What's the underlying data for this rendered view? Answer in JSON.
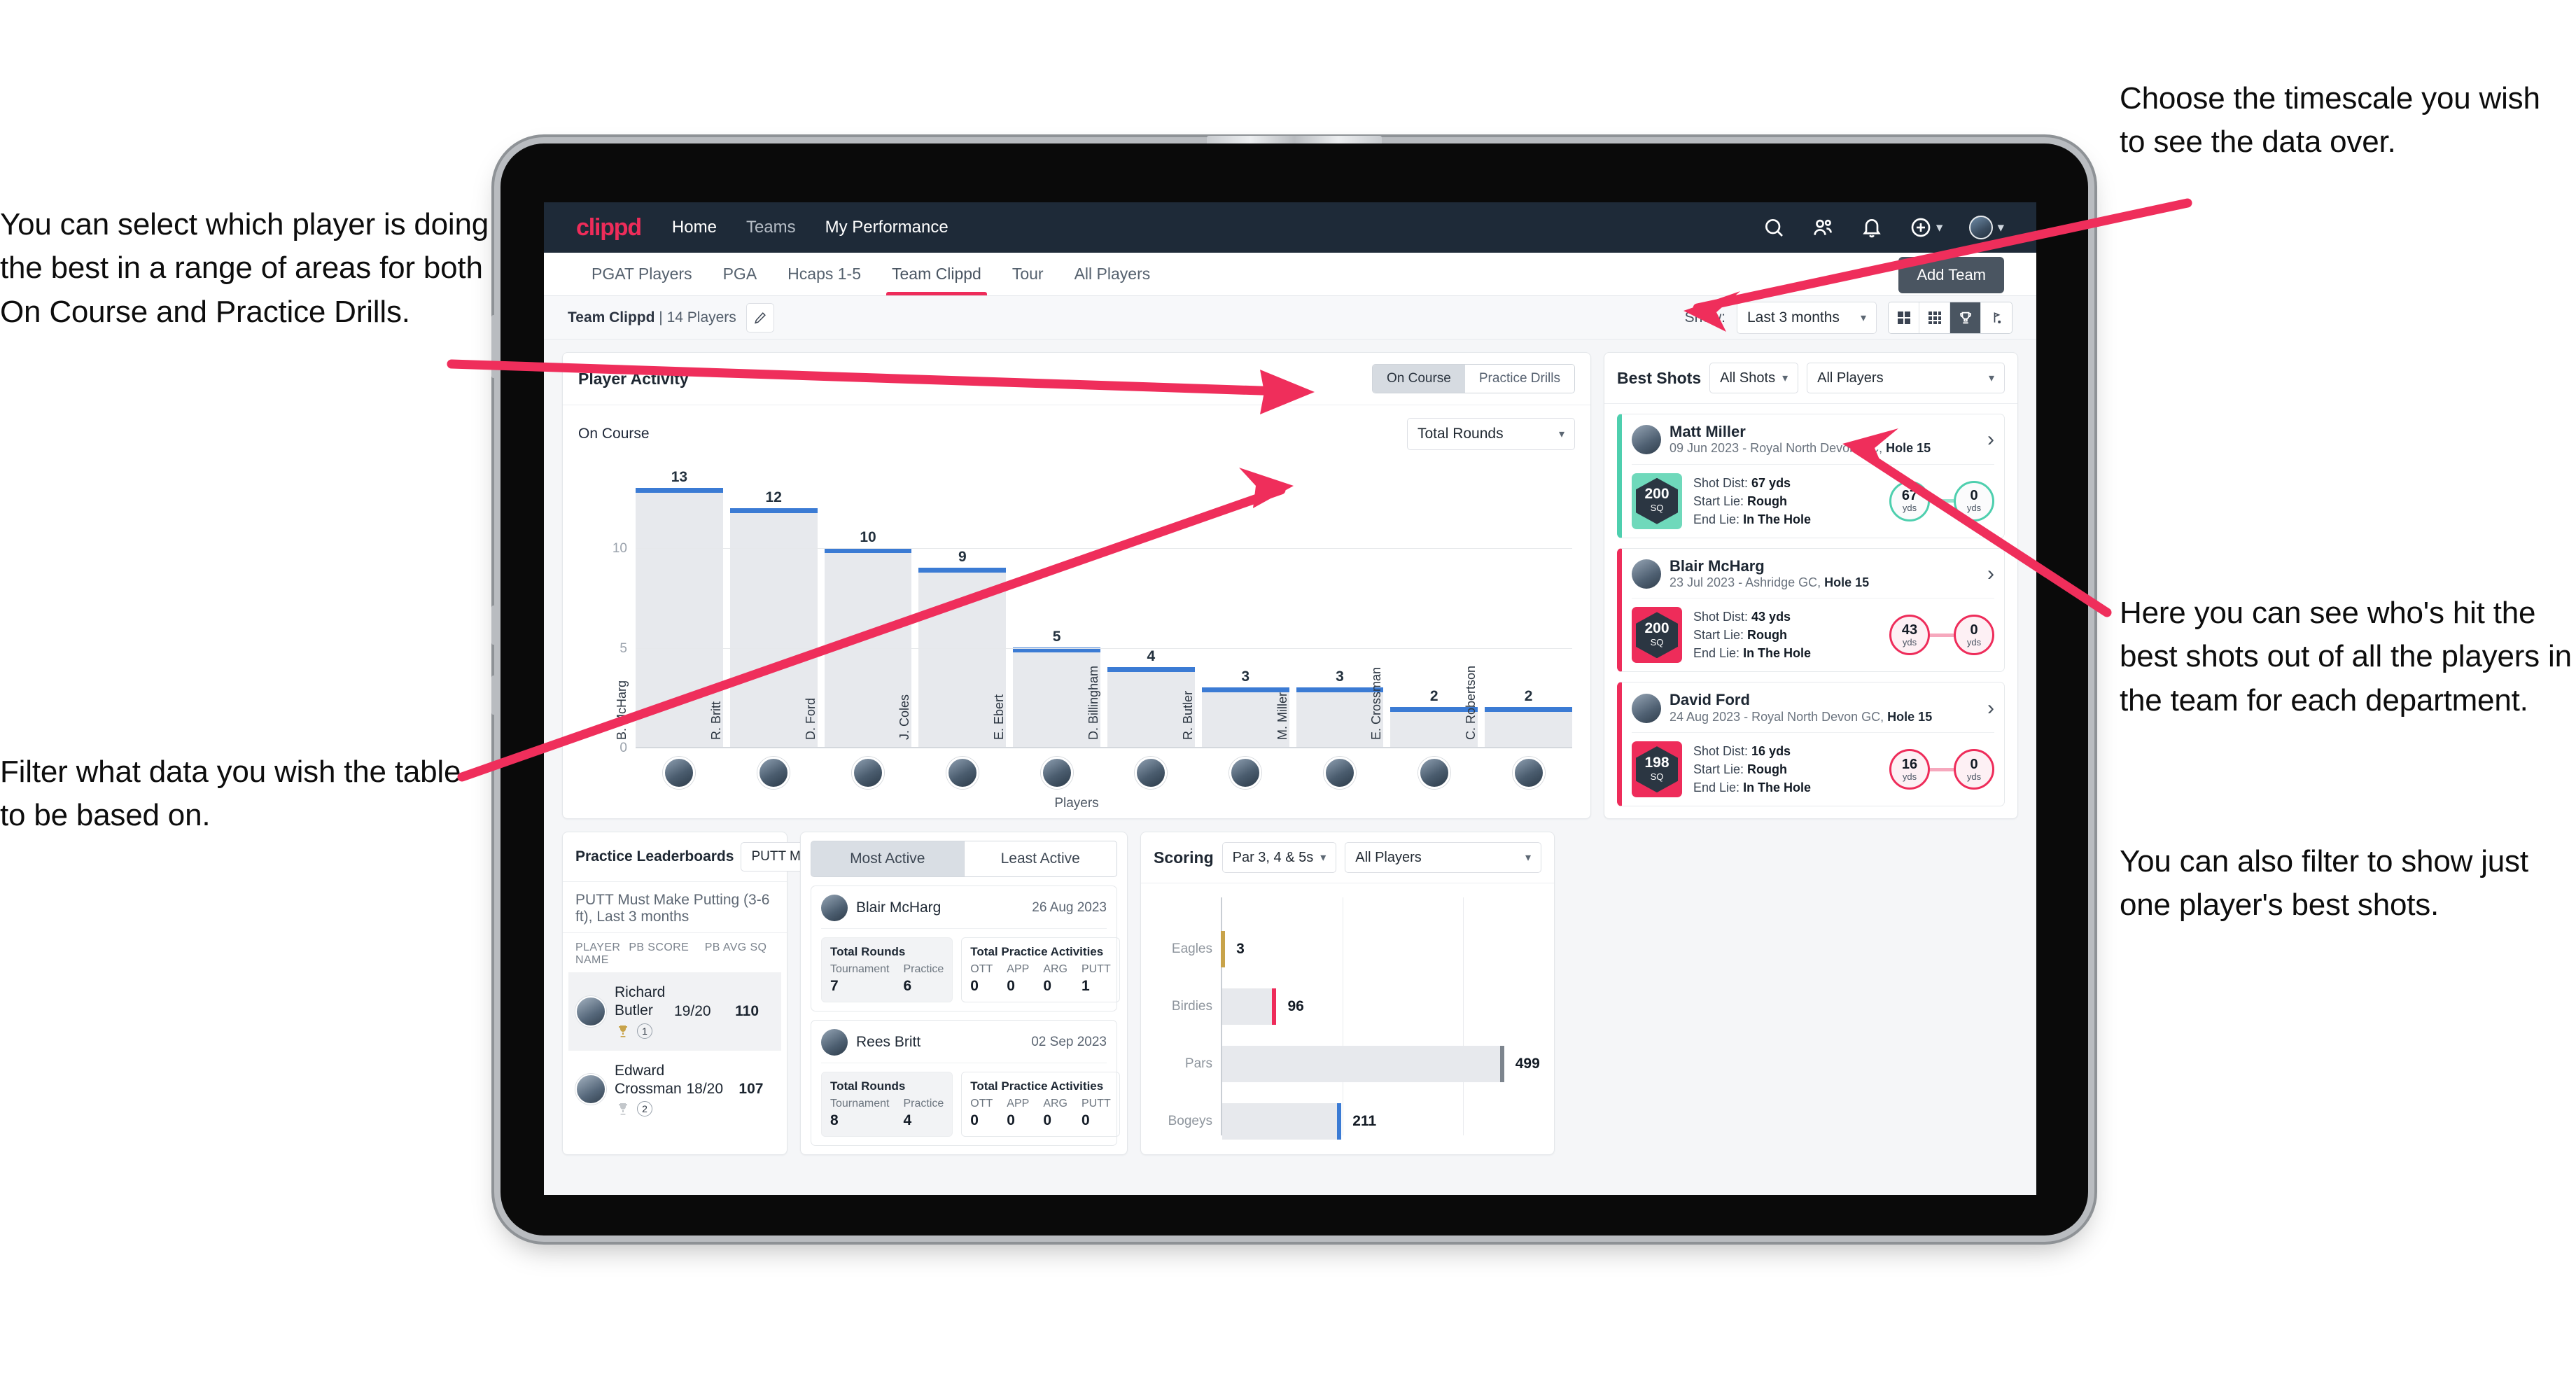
{
  "annotations": {
    "left_top": "You can select which player is doing the best in a range of areas for both On Course and Practice Drills.",
    "left_bottom": "Filter what data you wish the table to be based on.",
    "right_top": "Choose the timescale you wish to see the data over.",
    "right_mid": "Here you can see who's hit the best shots out of all the players in the team for each department.",
    "right_bottom": "You can also filter to show just one player's best shots."
  },
  "topnav": {
    "brand": "clippd",
    "links": [
      {
        "label": "Home",
        "active": true
      },
      {
        "label": "Teams",
        "active": false
      },
      {
        "label": "My Performance",
        "active": false
      }
    ],
    "icons": [
      "search-icon",
      "people-icon",
      "bell-icon",
      "plus-circle-icon",
      "avatar-icon"
    ]
  },
  "tabs": [
    {
      "label": "PGAT Players",
      "active": false
    },
    {
      "label": "PGA",
      "active": false
    },
    {
      "label": "Hcaps 1-5",
      "active": false
    },
    {
      "label": "Team Clippd",
      "active": true
    },
    {
      "label": "Tour",
      "active": false
    },
    {
      "label": "All Players",
      "active": false
    }
  ],
  "add_team_button": "Add Team",
  "toolbar": {
    "team_label": "Team Clippd",
    "team_count": " | 14 Players",
    "show_label": "Show:",
    "timescale_value": "Last 3 months",
    "view_buttons": [
      "grid-large-icon",
      "grid-small-icon",
      "trophy-icon",
      "golf-flag-icon"
    ],
    "active_view": 2
  },
  "player_activity": {
    "title": "Player Activity",
    "segments": [
      {
        "label": "On Course",
        "active": true
      },
      {
        "label": "Practice Drills",
        "active": false
      }
    ],
    "sub_label": "On Course",
    "metric_select": "Total Rounds"
  },
  "chart_data": [
    {
      "type": "bar",
      "title": "Player Activity",
      "xlabel": "Players",
      "ylabel": "Total Rounds",
      "ylim": [
        0,
        14
      ],
      "yticks": [
        0,
        5,
        10
      ],
      "grid": true,
      "categories": [
        "B. McHarg",
        "R. Britt",
        "D. Ford",
        "J. Coles",
        "E. Ebert",
        "D. Billingham",
        "R. Butler",
        "M. Miller",
        "E. Crossman",
        "C. Robertson"
      ],
      "values": [
        13,
        12,
        10,
        9,
        5,
        4,
        3,
        3,
        2,
        2
      ],
      "bar_color": "#e7e9ed",
      "cap_color": "#3b7bd4"
    },
    {
      "type": "bar",
      "orientation": "horizontal",
      "title": "Scoring",
      "categories": [
        "Eagles",
        "Birdies",
        "Pars",
        "Bogeys"
      ],
      "values": [
        3,
        96,
        499,
        211
      ],
      "xlim": [
        0,
        560
      ],
      "grid": true,
      "cap_colors": [
        "#c8a34a",
        "#ee2c5a",
        "#7d858e",
        "#3b7bd4"
      ],
      "bar_color": "#e7e9ed"
    }
  ],
  "best_shots": {
    "title": "Best Shots",
    "shot_filter": "All Shots",
    "player_filter": "All Players",
    "items": [
      {
        "name": "Matt Miller",
        "meta_date": "09 Jun 2023 - Royal North Devon GC, ",
        "meta_hole": "Hole 15",
        "sq": "200",
        "sq_unit": "SQ",
        "accent": "teal",
        "shot_dist_label": "Shot Dist: ",
        "shot_dist": "67 yds",
        "start_lie_label": "Start Lie: ",
        "start_lie": "Rough",
        "end_lie_label": "End Lie: ",
        "end_lie": "In The Hole",
        "from_val": "67",
        "from_unit": "yds",
        "to_val": "0",
        "to_unit": "yds"
      },
      {
        "name": "Blair McHarg",
        "meta_date": "23 Jul 2023 - Ashridge GC, ",
        "meta_hole": "Hole 15",
        "sq": "200",
        "sq_unit": "SQ",
        "accent": "pink",
        "shot_dist_label": "Shot Dist: ",
        "shot_dist": "43 yds",
        "start_lie_label": "Start Lie: ",
        "start_lie": "Rough",
        "end_lie_label": "End Lie: ",
        "end_lie": "In The Hole",
        "from_val": "43",
        "from_unit": "yds",
        "to_val": "0",
        "to_unit": "yds"
      },
      {
        "name": "David Ford",
        "meta_date": "24 Aug 2023 - Royal North Devon GC, ",
        "meta_hole": "Hole 15",
        "sq": "198",
        "sq_unit": "SQ",
        "accent": "pink",
        "shot_dist_label": "Shot Dist: ",
        "shot_dist": "16 yds",
        "start_lie_label": "Start Lie: ",
        "start_lie": "Rough",
        "end_lie_label": "End Lie: ",
        "end_lie": "In The Hole",
        "from_val": "16",
        "from_unit": "yds",
        "to_val": "0",
        "to_unit": "yds"
      }
    ]
  },
  "practice_leaderboards": {
    "title": "Practice Leaderboards",
    "drill_select": "PUTT Must Make Putting ...",
    "subtitle_bold": "PUTT Must Make Putting (3-6 ft),",
    "subtitle_light": " Last 3 months",
    "columns": [
      "PLAYER NAME",
      "PB SCORE",
      "PB AVG SQ"
    ],
    "rows": [
      {
        "name": "Richard Butler",
        "rank": "1",
        "trophy": "gold",
        "pb_score": "19/20",
        "pb_avg_sq": "110"
      },
      {
        "name": "Edward Crossman",
        "rank": "2",
        "trophy": "silver",
        "pb_score": "18/20",
        "pb_avg_sq": "107"
      }
    ]
  },
  "activity": {
    "tabs": [
      {
        "label": "Most Active",
        "active": true
      },
      {
        "label": "Least Active",
        "active": false
      }
    ],
    "cards": [
      {
        "name": "Blair McHarg",
        "date": "26 Aug 2023",
        "rounds_title": "Total Rounds",
        "rounds": [
          {
            "k": "Tournament",
            "v": "7"
          },
          {
            "k": "Practice",
            "v": "6"
          }
        ],
        "practice_title": "Total Practice Activities",
        "practice": [
          {
            "k": "OTT",
            "v": "0"
          },
          {
            "k": "APP",
            "v": "0"
          },
          {
            "k": "ARG",
            "v": "0"
          },
          {
            "k": "PUTT",
            "v": "1"
          }
        ]
      },
      {
        "name": "Rees Britt",
        "date": "02 Sep 2023",
        "rounds_title": "Total Rounds",
        "rounds": [
          {
            "k": "Tournament",
            "v": "8"
          },
          {
            "k": "Practice",
            "v": "4"
          }
        ],
        "practice_title": "Total Practice Activities",
        "practice": [
          {
            "k": "OTT",
            "v": "0"
          },
          {
            "k": "APP",
            "v": "0"
          },
          {
            "k": "ARG",
            "v": "0"
          },
          {
            "k": "PUTT",
            "v": "0"
          }
        ]
      }
    ]
  },
  "scoring": {
    "title": "Scoring",
    "par_filter": "Par 3, 4 & 5s",
    "player_filter": "All Players"
  },
  "colors": {
    "brand_pink": "#ee2c5a",
    "nav_dark": "#1e2a38",
    "bar_blue": "#3b7bd4",
    "teal": "#4ecfae",
    "gold": "#c8a34a"
  }
}
